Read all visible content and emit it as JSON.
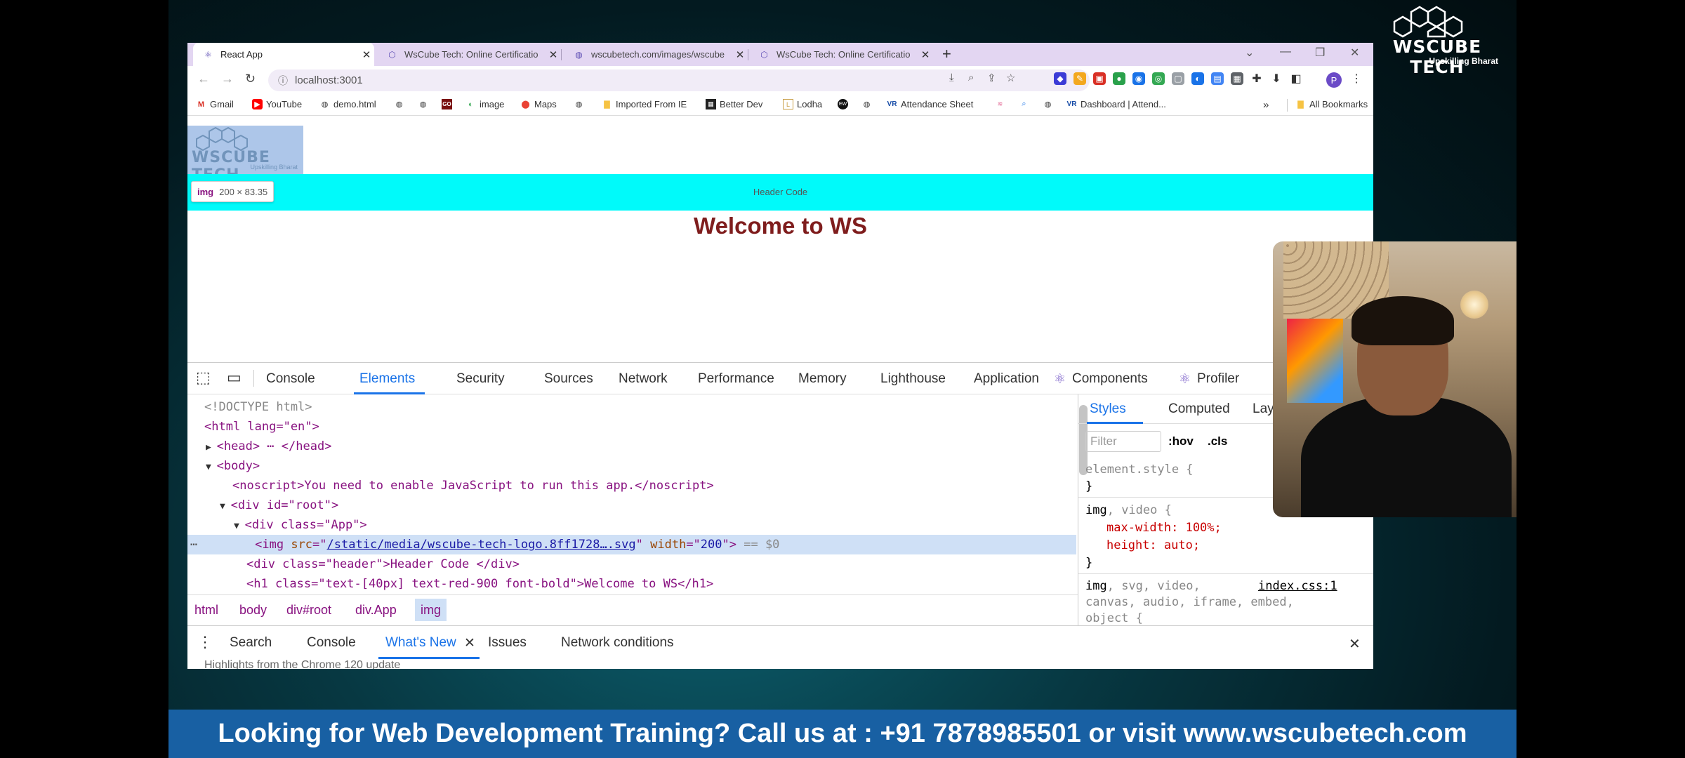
{
  "brand": {
    "name": "WSCUBE TECH",
    "tagline": "Upskilling Bharat"
  },
  "browser": {
    "tabs": [
      {
        "title": "React App",
        "active": true
      },
      {
        "title": "WsCube Tech: Online Certificatio",
        "active": false
      },
      {
        "title": "wscubetech.com/images/wscube",
        "active": false
      },
      {
        "title": "WsCube Tech: Online Certificatio",
        "active": false
      }
    ],
    "new_tab": "+",
    "url": "localhost:3001",
    "avatar_initial": "P",
    "bookmarks": [
      {
        "label": "Gmail",
        "icon": "gmail-icon"
      },
      {
        "label": "YouTube",
        "icon": "youtube-icon"
      },
      {
        "label": "demo.html",
        "icon": "globe-icon"
      },
      {
        "label": "",
        "icon": "globe-icon"
      },
      {
        "label": "",
        "icon": "globe-icon"
      },
      {
        "label": "GO",
        "icon": "go-icon"
      },
      {
        "label": "image",
        "icon": "image-icon"
      },
      {
        "label": "Maps",
        "icon": "maps-icon"
      },
      {
        "label": "",
        "icon": "globe-icon"
      },
      {
        "label": "Imported From IE",
        "icon": "folder-icon"
      },
      {
        "label": "Better Dev",
        "icon": "betterdev-icon"
      },
      {
        "label": "Lodha",
        "icon": "lodha-icon"
      },
      {
        "label": "",
        "icon": "ew-icon"
      },
      {
        "label": "",
        "icon": "globe-icon"
      },
      {
        "label": "Attendance Sheet",
        "icon": "vr-icon"
      },
      {
        "label": "",
        "icon": "sheet-icon"
      },
      {
        "label": "",
        "icon": "search-icon"
      },
      {
        "label": "",
        "icon": "globe-icon"
      },
      {
        "label": "Dashboard | Attend...",
        "icon": "vr-icon"
      }
    ],
    "bookmarks_overflow": "»",
    "all_bookmarks": "All Bookmarks"
  },
  "page": {
    "header_text": "Header Code",
    "heading": "Welcome to WS",
    "logo_name": "WSCUBE TECH",
    "logo_tagline": "Upskilling Bharat",
    "tooltip_tag": "img",
    "tooltip_size": "200 × 83.35"
  },
  "devtools": {
    "tabs": [
      "Console",
      "Elements",
      "Security",
      "Sources",
      "Network",
      "Performance",
      "Memory",
      "Lighthouse",
      "Application",
      "Components",
      "Profiler"
    ],
    "active_tab": "Elements",
    "dom": {
      "doctype": "<!DOCTYPE html>",
      "html_open": "<html lang=\"en\">",
      "head": "<head> ⋯ </head>",
      "body_open": "<body>",
      "noscript": "<noscript>You need to enable JavaScript to run this app.</noscript>",
      "root_div": "<div id=\"root\">",
      "app_div": "<div class=\"App\">",
      "img_src": "/static/media/wscube-tech-logo.8ff1728….svg",
      "img_width": "200",
      "img_marker": "== $0",
      "header_div": "<div class=\"header\">Header Code </div>",
      "h1_line": "<h1 class=\"text-[40px] text-red-900 font-bold\">Welcome to WS</h1>"
    },
    "breadcrumbs": [
      "html",
      "body",
      "div#root",
      "div.App",
      "img"
    ],
    "styles": {
      "tabs": [
        "Styles",
        "Computed",
        "Layo"
      ],
      "filter_placeholder": "Filter",
      "hov": ":hov",
      "cls": ".cls",
      "element_style": "element.style {",
      "close_brace": "}",
      "rule1_selector_main": "img",
      "rule1_selector_rest": ", video {",
      "rule1_decl1": "max-width: 100%;",
      "rule1_decl2": "height: auto;",
      "rule2_selector_main": "img",
      "rule2_selector_rest": ", svg, video,",
      "rule2_selector_line2": "canvas, audio, iframe, embed,",
      "rule2_selector_line3": "object {",
      "rule2_source": "index.css:1"
    },
    "drawer": {
      "tabs": [
        "Search",
        "Console",
        "What's New",
        "Issues",
        "Network conditions"
      ],
      "active": "What's New",
      "highlight": "Highlights from the Chrome 120 update"
    }
  },
  "banner": "Looking for Web Development Training? Call us at : +91 7878985501 or visit www.wscubetech.com"
}
